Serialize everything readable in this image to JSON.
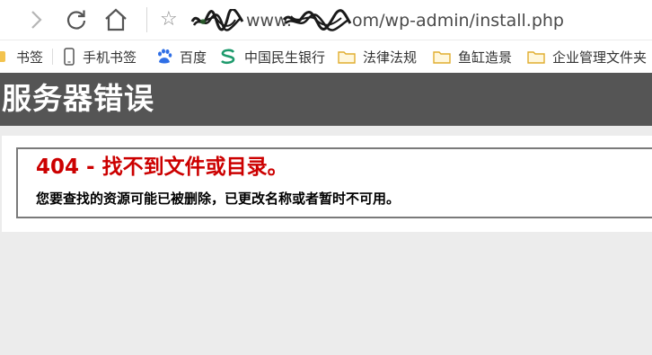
{
  "toolbar": {
    "forward_icon": "chevron-right-icon",
    "reload_icon": "reload-icon",
    "home_icon": "home-icon",
    "star_icon": "star-icon",
    "star_glyph": "☆",
    "url_part1": "www.",
    "url_part2": "om/wp-admin/install.php"
  },
  "bookmarks": {
    "items": [
      {
        "label": "书签",
        "icon": "bookmark-partial-icon"
      },
      {
        "label": "手机书签",
        "icon": "phone-icon"
      },
      {
        "label": "百度",
        "icon": "baidu-paw-icon"
      },
      {
        "label": "中国民生银行",
        "icon": "minsheng-bank-icon"
      },
      {
        "label": "法律法规",
        "icon": "folder-icon"
      },
      {
        "label": "鱼缸造景",
        "icon": "folder-icon"
      },
      {
        "label": "企业管理文件夹",
        "icon": "folder-icon"
      }
    ]
  },
  "error_page": {
    "header": "服务器错误",
    "code_line": "404 - 找不到文件或目录。",
    "description": "您要查找的资源可能已被删除，已更改名称或者暂时不可用。"
  },
  "colors": {
    "header_bg": "#555555",
    "error_red": "#cc0000",
    "folder_yellow": "#f3c34e",
    "baidu_blue": "#2f6fe6",
    "minsheng_green": "#1d9a6c"
  }
}
